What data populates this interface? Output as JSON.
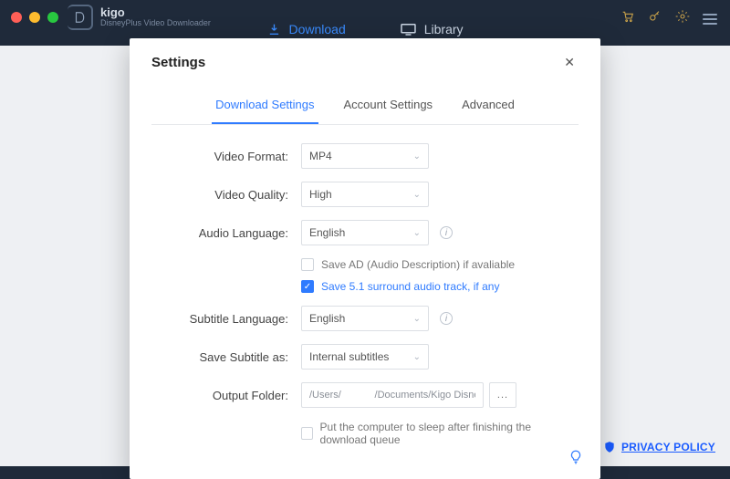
{
  "brand": {
    "name": "kigo",
    "subtitle": "DisneyPlus Video Downloader"
  },
  "mainnav": {
    "download": "Download",
    "library": "Library"
  },
  "modal": {
    "title": "Settings",
    "tabs": {
      "download": "Download Settings",
      "account": "Account Settings",
      "advanced": "Advanced"
    },
    "labels": {
      "video_format": "Video Format:",
      "video_quality": "Video Quality:",
      "audio_language": "Audio Language:",
      "subtitle_language": "Subtitle Language:",
      "save_subtitle_as": "Save Subtitle as:",
      "output_folder": "Output Folder:"
    },
    "values": {
      "video_format": "MP4",
      "video_quality": "High",
      "audio_language": "English",
      "subtitle_language": "English",
      "save_subtitle_as": "Internal subtitles",
      "output_folder": "/Users/            /Documents/Kigo DisneyPlus \\"
    },
    "checkboxes": {
      "save_ad": {
        "label": "Save AD (Audio Description) if avaliable",
        "checked": false
      },
      "save_51": {
        "label": "Save 5.1 surround audio track, if any",
        "checked": true
      },
      "sleep": {
        "label": "Put the computer to sleep after finishing the download queue",
        "checked": false
      }
    },
    "more_button": "..."
  },
  "footer": {
    "privacy": "PRIVACY POLICY"
  }
}
